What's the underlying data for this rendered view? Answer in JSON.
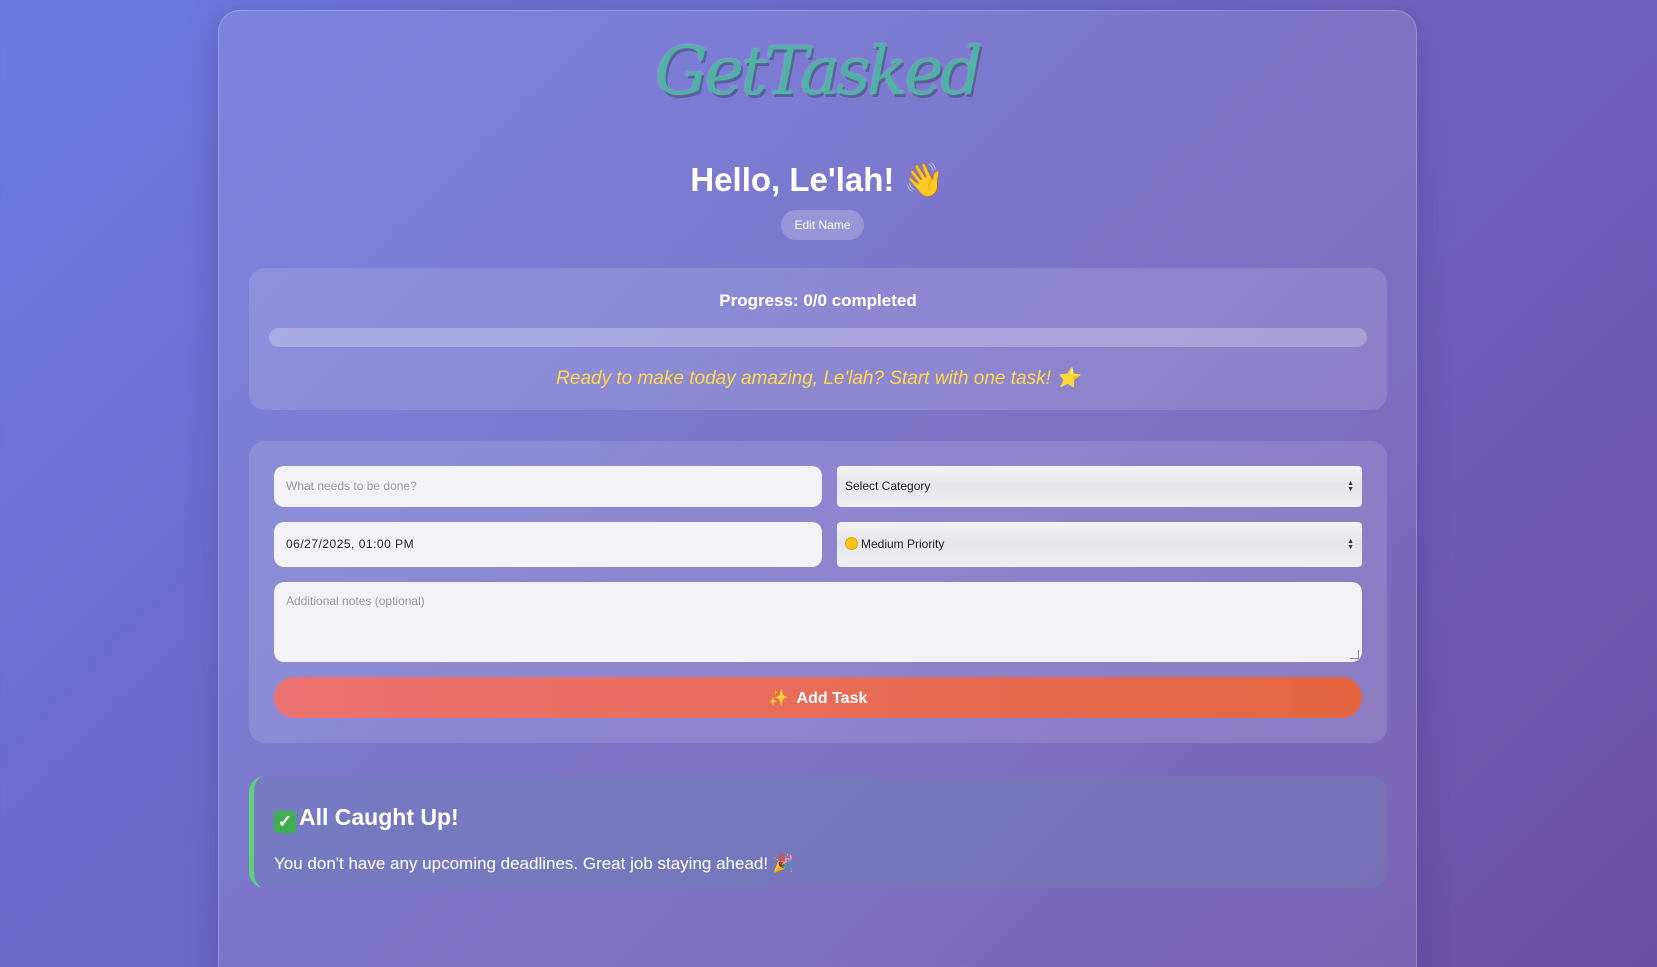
{
  "app": {
    "logo_text": "GetTasked"
  },
  "header": {
    "greeting": "Hello, Le'lah! 👋",
    "edit_name_label": "Edit Name"
  },
  "progress": {
    "label": "Progress: 0/0 completed",
    "completed": 0,
    "total": 0,
    "fill_fraction": 0,
    "motivation": "Ready to make today amazing, Le'lah? Start with one task! ⭐"
  },
  "task_form": {
    "task_placeholder": "What needs to be done?",
    "category_selected": "Select Category",
    "datetime_value": "06/27/2025, 01:00 PM",
    "priority_selected": "Medium Priority",
    "priority_icon": "yellow-circle-icon",
    "notes_placeholder": "Additional notes (optional)",
    "add_button_icon": "✨",
    "add_button_label": "Add Task"
  },
  "deadlines": {
    "icon": "✓",
    "title": "All Caught Up!",
    "message": "You don't have any upcoming deadlines. Great job staying ahead! 🎉"
  },
  "colors": {
    "accent_orange": "#e4653e",
    "accent_yellow": "#ffd84d",
    "success_green": "#5fcf7a",
    "logo_teal": "#4fb3a3"
  }
}
